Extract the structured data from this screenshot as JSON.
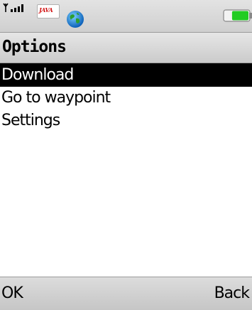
{
  "status_bar": {
    "signal_icon": "signal-strength-icon",
    "java_icon": "java-icon",
    "java_label": "JAVA",
    "globe_icon": "globe-icon",
    "battery_icon": "battery-icon",
    "battery_level": 0.7,
    "battery_color": "#22cc22"
  },
  "title_bar": {
    "title": "Options"
  },
  "menu": {
    "items": [
      {
        "label": "Download",
        "selected": true
      },
      {
        "label": "Go to waypoint",
        "selected": false
      },
      {
        "label": "Settings",
        "selected": false
      }
    ],
    "selection_color": "#000000"
  },
  "softkeys": {
    "left_label": "OK",
    "right_label": "Back"
  }
}
